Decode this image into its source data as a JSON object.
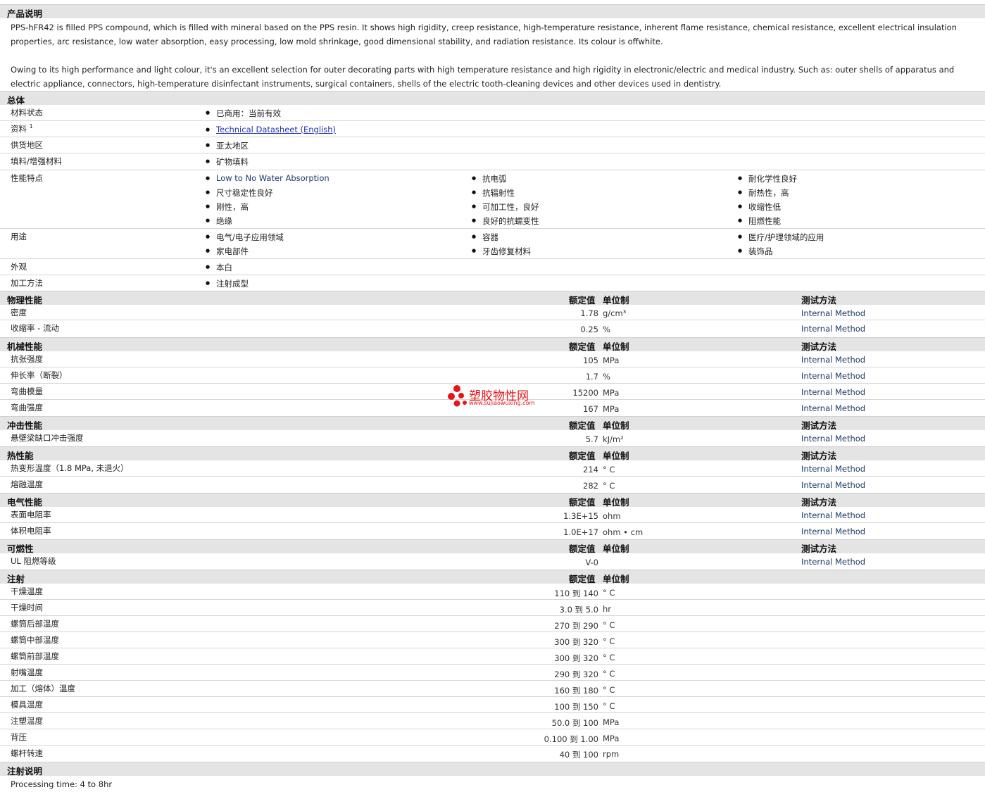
{
  "desc": {
    "title": "产品说明",
    "p1": "PPS-hFR42 is filled PPS compound, which is filled with mineral based on the PPS resin. It shows high rigidity, creep resistance, high-temperature resistance, inherent flame resistance, chemical resistance, excellent electrical insulation properties, arc resistance, low water absorption, easy processing, low mold shrinkage, good dimensional stability, and radiation resistance. Its colour is offwhite.",
    "p2": "Owing to its high performance and light colour, it's an excellent selection for outer decorating parts with high temperature resistance and high rigidity in electronic/electric and medical industry. Such as: outer shells of apparatus and electric appliance, connectors, high-temperature disinfectant instruments, surgical containers, shells of the electric tooth-cleaning devices and other devices used in dentistry."
  },
  "general": {
    "title": "总体",
    "status_label": "材料状态",
    "status": "已商用：当前有效",
    "docs_label": "资料",
    "docs_sup": "1",
    "docs_link": "Technical Datasheet (English)",
    "region_label": "供货地区",
    "region": "亚太地区",
    "filler_label": "填料/增强材料",
    "filler": "矿物填料",
    "features_label": "性能特点",
    "features": [
      "Low to No Water Absorption",
      "尺寸稳定性良好",
      "刚性，高",
      "绝缘",
      "抗电弧",
      "抗辐射性",
      "可加工性，良好",
      "良好的抗蠕变性",
      "耐化学性良好",
      "耐热性，高",
      "收缩性低",
      "阻燃性能"
    ],
    "uses_label": "用途",
    "uses": [
      "电气/电子应用领域",
      "家电部件",
      "容器",
      "牙齿修复材料",
      "医疗/护理领域的应用",
      "装饰品"
    ],
    "appearance_label": "外观",
    "appearance": "本白",
    "method_label": "加工方法",
    "method": "注射成型"
  },
  "headers": {
    "value": "额定值",
    "unit": "单位制",
    "method": "测试方法"
  },
  "physical": {
    "title": "物理性能",
    "rows": [
      {
        "label": "密度",
        "value": "1.78",
        "unit": "g/cm³",
        "method": "Internal Method"
      },
      {
        "label": "收缩率 - 流动",
        "value": "0.25",
        "unit": "%",
        "method": "Internal Method"
      }
    ]
  },
  "mechanical": {
    "title": "机械性能",
    "rows": [
      {
        "label": "抗张强度",
        "value": "105",
        "unit": "MPa",
        "method": "Internal Method"
      },
      {
        "label": "伸长率（断裂）",
        "value": "1.7",
        "unit": "%",
        "method": "Internal Method"
      },
      {
        "label": "弯曲模量",
        "value": "15200",
        "unit": "MPa",
        "method": "Internal Method"
      },
      {
        "label": "弯曲强度",
        "value": "167",
        "unit": "MPa",
        "method": "Internal Method"
      }
    ]
  },
  "impact": {
    "title": "冲击性能",
    "rows": [
      {
        "label": "悬壁梁缺口冲击强度",
        "value": "5.7",
        "unit": "kJ/m²",
        "method": "Internal Method"
      }
    ]
  },
  "thermal": {
    "title": "热性能",
    "rows": [
      {
        "label": "热变形温度（1.8 MPa, 未退火）",
        "value": "214",
        "unit": "° C",
        "method": "Internal Method"
      },
      {
        "label": "熔融温度",
        "value": "282",
        "unit": "° C",
        "method": "Internal Method"
      }
    ]
  },
  "electrical": {
    "title": "电气性能",
    "rows": [
      {
        "label": "表面电阻率",
        "value": "1.3E+15",
        "unit": "ohm",
        "method": "Internal Method"
      },
      {
        "label": "体积电阻率",
        "value": "1.0E+17",
        "unit": "ohm • cm",
        "method": "Internal Method"
      }
    ]
  },
  "flammability": {
    "title": "可燃性",
    "rows": [
      {
        "label": "UL 阻燃等级",
        "value": "V-0",
        "unit": "",
        "method": "Internal Method"
      }
    ]
  },
  "injection": {
    "title": "注射",
    "rows": [
      {
        "label": "干燥温度",
        "value": "110 到  140",
        "unit": "° C"
      },
      {
        "label": "干燥时间",
        "value": "3.0 到  5.0",
        "unit": "hr"
      },
      {
        "label": "螺筒后部温度",
        "value": "270 到  290",
        "unit": "° C"
      },
      {
        "label": "螺筒中部温度",
        "value": "300 到  320",
        "unit": "° C"
      },
      {
        "label": "螺筒前部温度",
        "value": "300 到  320",
        "unit": "° C"
      },
      {
        "label": "射嘴温度",
        "value": "290 到  320",
        "unit": "° C"
      },
      {
        "label": "加工（熔体）温度",
        "value": "160 到  180",
        "unit": "° C"
      },
      {
        "label": "模具温度",
        "value": "100 到  150",
        "unit": "° C"
      },
      {
        "label": "注塑温度",
        "value": "50.0 到  100",
        "unit": "MPa"
      },
      {
        "label": "背压",
        "value": "0.100 到  1.00",
        "unit": "MPa"
      },
      {
        "label": "螺杆转速",
        "value": "40 到  100",
        "unit": "rpm"
      }
    ]
  },
  "injection_notes": {
    "title": "注射说明",
    "text": "Processing time: 4 to 8hr"
  },
  "watermark": {
    "name": "塑胶物性网",
    "url": "www.sujiaowuxing.com",
    "dot_color": "#e8141a"
  }
}
